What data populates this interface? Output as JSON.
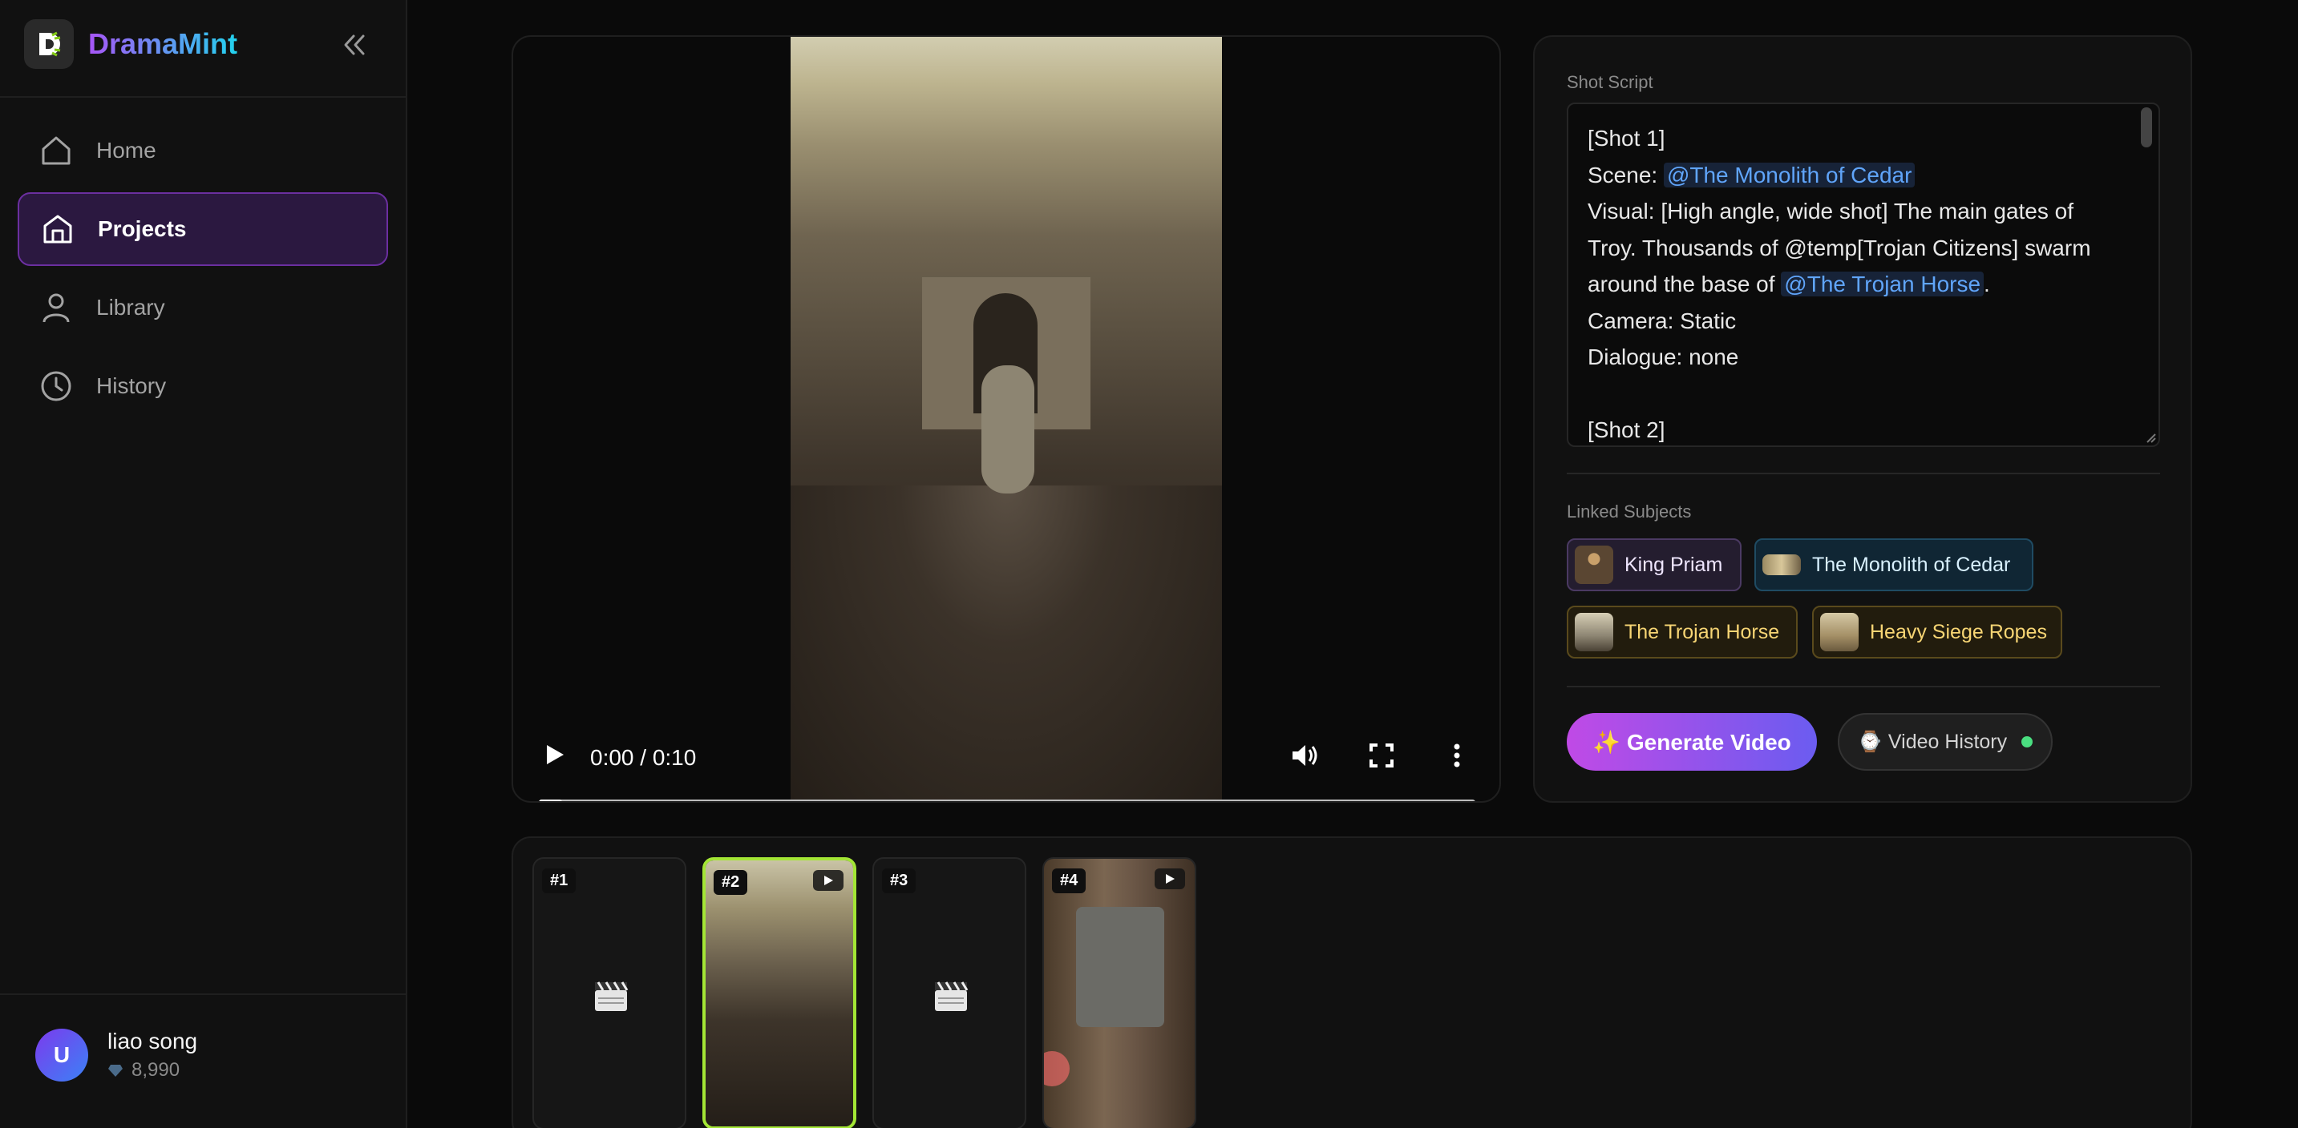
{
  "app": {
    "name": "DramaMint",
    "logo_icon": "dramamint-logo-icon"
  },
  "sidebar": {
    "collapse_icon": "double-chevron-left-icon",
    "items": [
      {
        "label": "Home",
        "icon": "home-icon",
        "active": false
      },
      {
        "label": "Projects",
        "icon": "projects-icon",
        "active": true
      },
      {
        "label": "Library",
        "icon": "user-icon",
        "active": false
      },
      {
        "label": "History",
        "icon": "clock-icon",
        "active": false
      }
    ],
    "user": {
      "initial": "U",
      "name": "liao song",
      "credits": "8,990",
      "credits_icon": "gem-icon"
    }
  },
  "player": {
    "time": "0:00 / 0:10",
    "progress_fraction": 0.025,
    "icons": [
      "play-icon",
      "volume-icon",
      "fullscreen-icon",
      "more-vert-icon"
    ]
  },
  "script": {
    "label": "Shot Script",
    "lines": {
      "l1": "[Shot 1]",
      "l2_prefix": "Scene: ",
      "l2_ref": "@The Monolith of Cedar",
      "l3": "Visual: [High angle, wide shot] The main gates of",
      "l4": "Troy. Thousands of @temp[Trojan Citizens] swarm",
      "l5_prefix": "around the base of ",
      "l5_ref": "@The Trojan Horse",
      "l5_suffix": ".",
      "l6": "Camera: Static",
      "l7": "Dialogue: none",
      "l8": "",
      "l9": "[Shot 2]"
    }
  },
  "linked_subjects": {
    "label": "Linked Subjects",
    "chips": [
      {
        "label": "King Priam",
        "kind": "person"
      },
      {
        "label": "The Monolith of Cedar",
        "kind": "scene"
      },
      {
        "label": "The Trojan Horse",
        "kind": "prop"
      },
      {
        "label": "Heavy Siege Ropes",
        "kind": "prop"
      }
    ]
  },
  "actions": {
    "generate_label": "✨ Generate Video",
    "history_label": "⌚ Video History",
    "history_status_color": "#4ade80"
  },
  "shots": [
    {
      "num": "#1",
      "has_media": false,
      "selected": false
    },
    {
      "num": "#2",
      "has_media": true,
      "selected": true
    },
    {
      "num": "#3",
      "has_media": false,
      "selected": false
    },
    {
      "num": "#4",
      "has_media": true,
      "selected": false
    }
  ],
  "colors": {
    "accent_purple": "#a855f7",
    "accent_cyan": "#22d3ee",
    "selected_shot": "#a3e635",
    "reference_blue": "#60a5fa"
  }
}
